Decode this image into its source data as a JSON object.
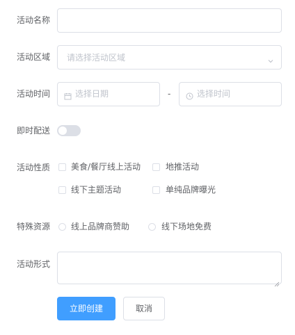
{
  "form": {
    "name": {
      "label": "活动名称",
      "value": ""
    },
    "region": {
      "label": "活动区域",
      "placeholder": "请选择活动区域",
      "icon": "chevron-down-icon"
    },
    "time": {
      "label": "活动时间",
      "date_placeholder": "选择日期",
      "separator": "-",
      "time_placeholder": "选择时间",
      "date_icon": "calendar-icon",
      "time_icon": "clock-icon"
    },
    "delivery": {
      "label": "即时配送",
      "enabled": false
    },
    "type": {
      "label": "活动性质",
      "options": [
        {
          "label": "美食/餐厅线上活动",
          "checked": false
        },
        {
          "label": "地推活动",
          "checked": false
        },
        {
          "label": "线下主题活动",
          "checked": false
        },
        {
          "label": "单纯品牌曝光",
          "checked": false
        }
      ]
    },
    "resource": {
      "label": "特殊资源",
      "options": [
        {
          "label": "线上品牌商赞助",
          "selected": false
        },
        {
          "label": "线下场地免费",
          "selected": false
        }
      ]
    },
    "desc": {
      "label": "活动形式",
      "value": ""
    },
    "buttons": {
      "submit": "立即创建",
      "cancel": "取消"
    }
  },
  "colors": {
    "primary": "#409eff",
    "border": "#dcdfe6",
    "text": "#606266",
    "placeholder": "#c0c4cc"
  }
}
